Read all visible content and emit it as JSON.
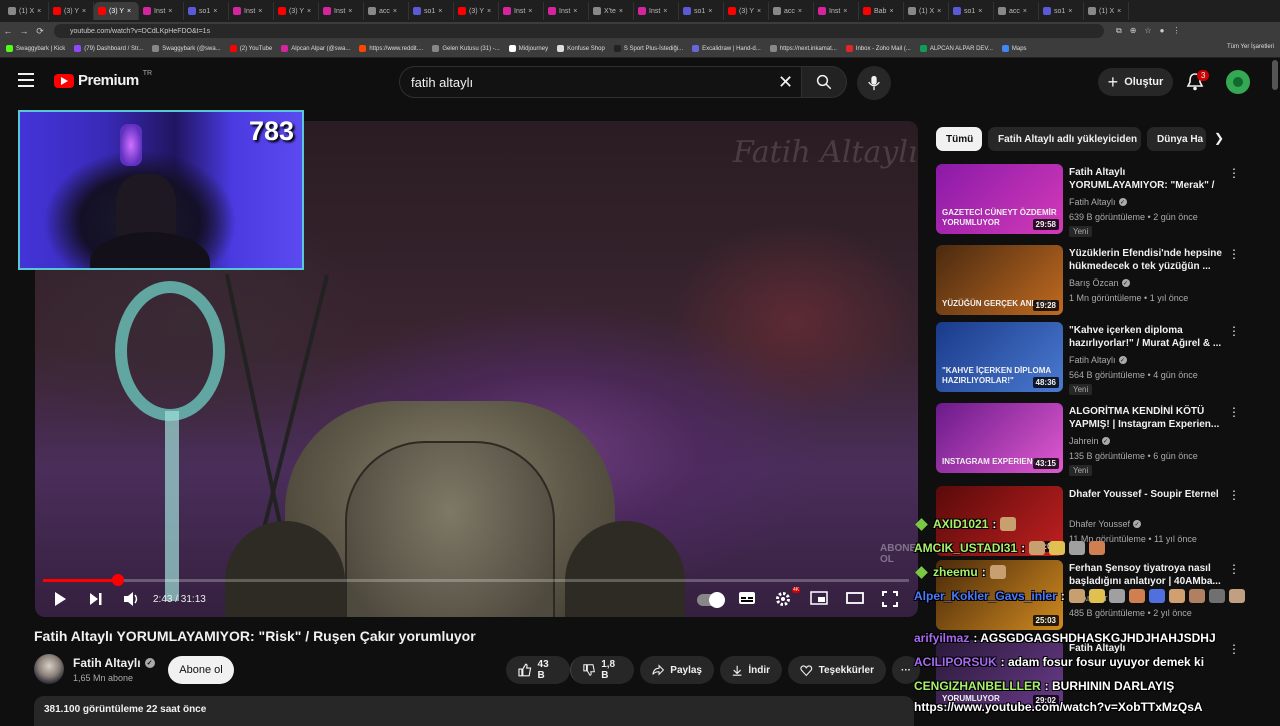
{
  "browser": {
    "tabs": [
      {
        "label": "(1) X",
        "color": "#888888"
      },
      {
        "label": "(3) Y",
        "color": "#ff0000"
      },
      {
        "label": "(3) Y",
        "color": "#ff0000",
        "active": true
      },
      {
        "label": "Inst",
        "color": "#d6249f"
      },
      {
        "label": "so1",
        "color": "#5a5ad6"
      },
      {
        "label": "Inst",
        "color": "#d6249f"
      },
      {
        "label": "(3) Y",
        "color": "#ff0000"
      },
      {
        "label": "Inst",
        "color": "#d6249f"
      },
      {
        "label": "acc",
        "color": "#888888"
      },
      {
        "label": "so1",
        "color": "#5a5ad6"
      },
      {
        "label": "(3) Y",
        "color": "#ff0000"
      },
      {
        "label": "Inst",
        "color": "#d6249f"
      },
      {
        "label": "Inst",
        "color": "#d6249f"
      },
      {
        "label": "X'te",
        "color": "#888888"
      },
      {
        "label": "Inst",
        "color": "#d6249f"
      },
      {
        "label": "so1",
        "color": "#5a5ad6"
      },
      {
        "label": "(3) Y",
        "color": "#ff0000"
      },
      {
        "label": "acc",
        "color": "#888888"
      },
      {
        "label": "Inst",
        "color": "#d6249f"
      },
      {
        "label": "Bab",
        "color": "#ff0000"
      },
      {
        "label": "(1) X",
        "color": "#888888"
      },
      {
        "label": "so1",
        "color": "#5a5ad6"
      },
      {
        "label": "acc",
        "color": "#888888"
      },
      {
        "label": "so1",
        "color": "#5a5ad6"
      },
      {
        "label": "(1) X",
        "color": "#888888"
      }
    ],
    "url": "youtube.com/watch?v=DCdLKpHeFDO&t=1s",
    "bookmarks": [
      {
        "label": "Swaggybark | Kick",
        "color": "#53fc18"
      },
      {
        "label": "(79) Dashboard / Str...",
        "color": "#9146ff"
      },
      {
        "label": "Swaggybark (@swa...",
        "color": "#888888"
      },
      {
        "label": "(2) YouTube",
        "color": "#ff0000"
      },
      {
        "label": "Alpcan Alpar (@swa...",
        "color": "#d6249f"
      },
      {
        "label": "https://www.reddit....",
        "color": "#ff4500"
      },
      {
        "label": "Gelen Kutusu (31) -...",
        "color": "#888888"
      },
      {
        "label": "Midjourney",
        "color": "#ffffff"
      },
      {
        "label": "Konfuse Shop",
        "color": "#dddddd"
      },
      {
        "label": "S Sport Plus-İstediği...",
        "color": "#222222"
      },
      {
        "label": "Excalidraw | Hand-d...",
        "color": "#6965db"
      },
      {
        "label": "https://next.inkamat...",
        "color": "#888888"
      },
      {
        "label": "Inbox - Zoho Mail (...",
        "color": "#e42527"
      },
      {
        "label": "ALPCAN ALPAR DEV...",
        "color": "#0f9d58"
      },
      {
        "label": "Maps",
        "color": "#4285f4"
      }
    ],
    "all_bookmarks": "Tüm Yer İşaretleri"
  },
  "header": {
    "logo": "Premium",
    "region": "TR",
    "search_value": "fatih altaylı",
    "create_label": "Oluştur",
    "notif_count": "3"
  },
  "player": {
    "watermark": "Fatih Altaylı",
    "channel_logo": "ABONE OL",
    "time": "2:43 / 31:13",
    "progress": 0.087,
    "hd_badge": "4K"
  },
  "overlay": {
    "counter": "783"
  },
  "video": {
    "title": "Fatih Altaylı YORUMLAYAMIYOR: \"Risk\" / Ruşen Çakır yorumluyor",
    "channel": "Fatih Altaylı",
    "subs": "1,65 Mn abone",
    "subscribe_label": "Abone ol",
    "likes": "43 B",
    "dislikes": "1,8 B",
    "share_label": "Paylaş",
    "download_label": "İndir",
    "thanks_label": "Teşekkürler",
    "more_label": "···",
    "stats": "381.100 görüntüleme  22 saat önce"
  },
  "chips": [
    {
      "label": "Tümü",
      "selected": true
    },
    {
      "label": "Fatih Altaylı adlı yükleyiciden"
    },
    {
      "label": "Dünya Ha"
    }
  ],
  "recommendations": [
    {
      "title": "Fatih Altaylı YORUMLAYAMIYOR: \"Merak\" / ...",
      "channel": "Fatih Altaylı",
      "verified": true,
      "meta": "639 B görüntüleme • 2 gün önce",
      "new": "Yeni",
      "duration": "29:58",
      "thumb_text": "GAZETECİ CÜNEYT ÖZDEMİR YORUMLUYOR",
      "c1": "#8a1aa8",
      "c2": "#d43ab8"
    },
    {
      "title": "Yüzüklerin Efendisi'nde hepsine hükmedecek o tek yüzüğün ...",
      "channel": "Barış Özcan",
      "verified": true,
      "meta": "1 Mn görüntüleme • 1 yıl önce",
      "new": "",
      "duration": "19:28",
      "thumb_text": "YÜZÜĞÜN GERÇEK ANLAMI",
      "c1": "#4a2a10",
      "c2": "#c06a20"
    },
    {
      "title": "\"Kahve içerken diploma hazırlıyorlar!\" / Murat Ağırel & ...",
      "channel": "Fatih Altaylı",
      "verified": true,
      "meta": "564 B görüntüleme • 4 gün önce",
      "new": "Yeni",
      "duration": "48:36",
      "thumb_text": "\"KAHVE İÇERKEN DİPLOMA HAZIRLIYORLAR!\"",
      "c1": "#1a3a8a",
      "c2": "#4a7ad0"
    },
    {
      "title": "ALGORİTMA KENDİNİ KÖTÜ YAPMIŞ! | Instagram Experien...",
      "channel": "Jahrein",
      "verified": true,
      "meta": "135 B görüntüleme • 6 gün önce",
      "new": "Yeni",
      "duration": "43:15",
      "thumb_text": "INSTAGRAM EXPERIENCE",
      "c1": "#6a1a8a",
      "c2": "#e05ad0"
    },
    {
      "title": "Dhafer Youssef - Soupir Eternel",
      "channel": "Dhafer Youssef",
      "verified": true,
      "meta": "11 Mn görüntüleme • 11 yıl önce",
      "new": "",
      "duration": "7:05",
      "thumb_text": "",
      "c1": "#5a0a0a",
      "c2": "#c02020"
    },
    {
      "title": "Ferhan Şensoy tiyatroya nasıl başladığını anlatıyor | 40AMba...",
      "channel": "40 Amper",
      "verified": false,
      "meta": "485 B görüntüleme • 2 yıl önce",
      "new": "",
      "duration": "25:03",
      "thumb_text": "",
      "c1": "#4a2a0a",
      "c2": "#d08a20"
    },
    {
      "title": "Fatih Altaylı",
      "channel": "",
      "verified": false,
      "meta": "",
      "new": "",
      "duration": "29:02",
      "thumb_text": "YORUMLUYOR",
      "c1": "#2a1a3a",
      "c2": "#6a3a8a"
    }
  ],
  "chat": [
    {
      "user": "AXID1021",
      "text": ":",
      "color": "#a8f06a",
      "badge": true,
      "emotes": 1
    },
    {
      "user": "AMCIK_USTADI31",
      "text": ":",
      "color": "#a8f06a",
      "badge": false,
      "emotes": 4
    },
    {
      "user": "zheemu",
      "text": ":",
      "color": "#a8f06a",
      "badge": true,
      "emotes": 1
    },
    {
      "user": "Alper_Kokler_Gavs_inler",
      "text": ":",
      "color": "#4a7aff",
      "badge": false,
      "emotes": 9
    },
    {
      "user": "arifyilmaz",
      "text": ": AGSGDGAGSHDHASKGJHDJHAHJSDHJ",
      "color": "#a86af0",
      "badge": false,
      "emotes": 0
    },
    {
      "user": "ACILIPORSUK",
      "text": ": adam fosur fosur uyuyor demek ki",
      "color": "#a86af0",
      "badge": false,
      "emotes": 0
    },
    {
      "user": "CENGIZHANBELLLER",
      "text": ": BURHININ DARLAYIŞ",
      "color": "#a8f06a",
      "badge": false,
      "emotes": 0
    },
    {
      "user": "",
      "text": "https://www.youtube.com/watch?v=XobTTxMzQsA",
      "color": "#ffffff",
      "badge": false,
      "emotes": 0
    }
  ],
  "colors": {
    "accent": "#ff0000",
    "bg": "#0f0f0f",
    "panel": "#272727"
  }
}
